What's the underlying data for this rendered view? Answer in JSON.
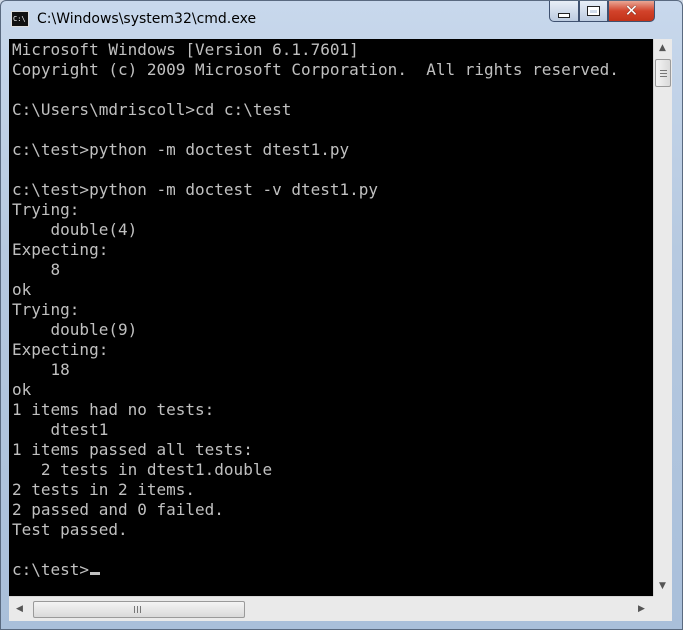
{
  "window": {
    "title": "C:\\Windows\\system32\\cmd.exe",
    "icon": "cmd-icon",
    "icon_text": "C:\\",
    "controls": {
      "minimize": "minimize-icon",
      "maximize": "maximize-icon",
      "close": "close-icon",
      "close_glyph": "✕"
    }
  },
  "console": {
    "lines": [
      "Microsoft Windows [Version 6.1.7601]",
      "Copyright (c) 2009 Microsoft Corporation.  All rights reserved.",
      "",
      "C:\\Users\\mdriscoll>cd c:\\test",
      "",
      "c:\\test>python -m doctest dtest1.py",
      "",
      "c:\\test>python -m doctest -v dtest1.py",
      "Trying:",
      "    double(4)",
      "Expecting:",
      "    8",
      "ok",
      "Trying:",
      "    double(9)",
      "Expecting:",
      "    18",
      "ok",
      "1 items had no tests:",
      "    dtest1",
      "1 items passed all tests:",
      "   2 tests in dtest1.double",
      "2 tests in 2 items.",
      "2 passed and 0 failed.",
      "Test passed.",
      "",
      "c:\\test>"
    ]
  },
  "scrollbars": {
    "up_arrow": "▲",
    "down_arrow": "▼",
    "left_arrow": "◀",
    "right_arrow": "▶"
  }
}
